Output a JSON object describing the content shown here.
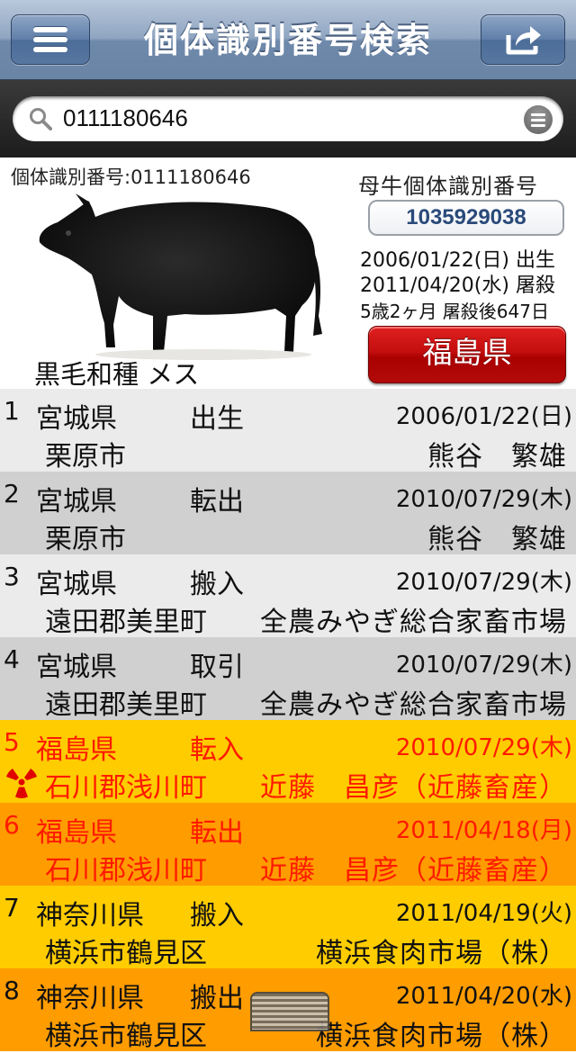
{
  "nav": {
    "title": "個体識別番号検索",
    "menu_icon": "hamburger-menu-icon",
    "share_icon": "share-export-icon",
    "bar_color": "#6f89ab"
  },
  "search": {
    "value": "0111180646",
    "icon": "search-icon",
    "bookmark_icon": "list-icon"
  },
  "cattle": {
    "id_label": "個体識別番号:0111180646",
    "breed_sex": "黒毛和種 メス",
    "mother_label": "母牛個体識別番号",
    "mother_id": "1035929038",
    "birth": "2006/01/22(日) 出生",
    "slaughter": "2011/04/20(水) 屠殺",
    "age": "5歳2ヶ月 屠殺後647日",
    "prefecture_button": "福島県",
    "prefecture_button_color": "#c40e0e"
  },
  "history": [
    {
      "num": "1",
      "pref": "宮城県",
      "event": "出生",
      "date": "2006/01/22(日)",
      "city": "栗原市",
      "owner": "熊谷　繁雄",
      "bg": "#ebebeb"
    },
    {
      "num": "2",
      "pref": "宮城県",
      "event": "転出",
      "date": "2010/07/29(木)",
      "city": "栗原市",
      "owner": "熊谷　繁雄",
      "bg": "#d0d0d0"
    },
    {
      "num": "3",
      "pref": "宮城県",
      "event": "搬入",
      "date": "2010/07/29(木)",
      "city": "遠田郡美里町",
      "owner": "全農みやぎ総合家畜市場",
      "bg": "#ebebeb"
    },
    {
      "num": "4",
      "pref": "宮城県",
      "event": "取引",
      "date": "2010/07/29(木)",
      "city": "遠田郡美里町",
      "owner": "全農みやぎ総合家畜市場",
      "bg": "#d0d0d0"
    },
    {
      "num": "5",
      "pref": "福島県",
      "event": "転入",
      "date": "2010/07/29(木)",
      "city": "石川郡浅川町",
      "owner": "近藤　昌彦（近藤畜産）",
      "bg": "#ffcc00",
      "text_color": "#ff1a00",
      "icon": "radiation-icon"
    },
    {
      "num": "6",
      "pref": "福島県",
      "event": "転出",
      "date": "2011/04/18(月)",
      "city": "石川郡浅川町",
      "owner": "近藤　昌彦（近藤畜産）",
      "bg": "#ff9c00",
      "text_color": "#ff1a00"
    },
    {
      "num": "7",
      "pref": "神奈川県",
      "event": "搬入",
      "date": "2011/04/19(火)",
      "city": "横浜市鶴見区",
      "owner": "横浜食肉市場（株）",
      "bg": "#ffcc00"
    },
    {
      "num": "8",
      "pref": "神奈川県",
      "event": "搬出",
      "date": "2011/04/20(水)",
      "city": "横浜市鶴見区",
      "owner": "横浜食肉市場（株）",
      "bg": "#ff9c00"
    }
  ]
}
